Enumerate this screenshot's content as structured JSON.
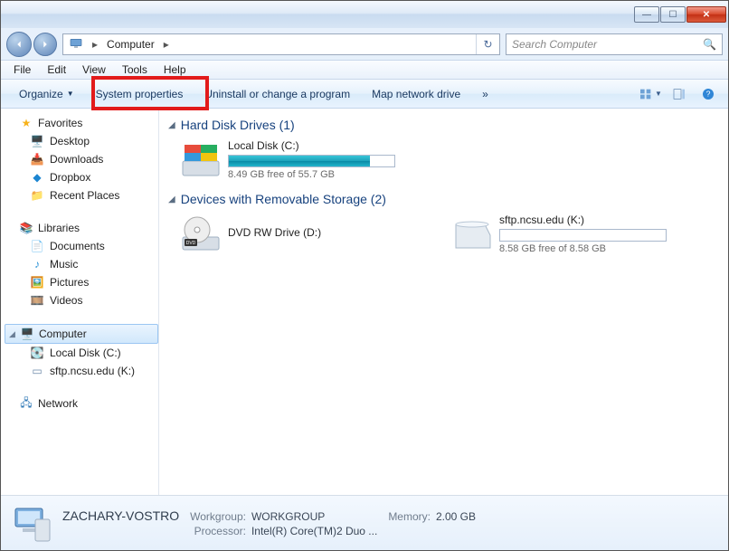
{
  "window_controls": {
    "min": "—",
    "max": "☐",
    "close": "✕"
  },
  "address": {
    "location": "Computer"
  },
  "search": {
    "placeholder": "Search Computer"
  },
  "menus": [
    "File",
    "Edit",
    "View",
    "Tools",
    "Help"
  ],
  "toolbar": {
    "organize": "Organize",
    "system_properties": "System properties",
    "uninstall": "Uninstall or change a program",
    "map_drive": "Map network drive",
    "more": "»"
  },
  "sidebar": {
    "favorites": {
      "label": "Favorites",
      "items": [
        {
          "label": "Desktop",
          "icon": "desktop-icon"
        },
        {
          "label": "Downloads",
          "icon": "downloads-icon"
        },
        {
          "label": "Dropbox",
          "icon": "dropbox-icon"
        },
        {
          "label": "Recent Places",
          "icon": "recent-places-icon"
        }
      ]
    },
    "libraries": {
      "label": "Libraries",
      "items": [
        {
          "label": "Documents",
          "icon": "documents-icon"
        },
        {
          "label": "Music",
          "icon": "music-icon"
        },
        {
          "label": "Pictures",
          "icon": "pictures-icon"
        },
        {
          "label": "Videos",
          "icon": "videos-icon"
        }
      ]
    },
    "computer": {
      "label": "Computer",
      "items": [
        {
          "label": "Local Disk (C:)",
          "icon": "hdd-icon"
        },
        {
          "label": "sftp.ncsu.edu (K:)",
          "icon": "drive-icon"
        }
      ]
    },
    "network": {
      "label": "Network"
    }
  },
  "content": {
    "sections": [
      {
        "title": "Hard Disk Drives (1)",
        "drives": [
          {
            "name": "Local Disk (C:)",
            "free_text": "8.49 GB free of 55.7 GB",
            "used_percent": 85,
            "icon": "hdd-large-icon"
          }
        ]
      },
      {
        "title": "Devices with Removable Storage (2)",
        "drives": [
          {
            "name": "DVD RW Drive (D:)",
            "free_text": "",
            "used_percent": null,
            "icon": "dvd-icon"
          },
          {
            "name": "sftp.ncsu.edu (K:)",
            "free_text": "8.58 GB free of 8.58 GB",
            "used_percent": 0,
            "icon": "removable-icon"
          }
        ]
      }
    ]
  },
  "details": {
    "name": "ZACHARY-VOSTRO",
    "workgroup_label": "Workgroup:",
    "workgroup": "WORKGROUP",
    "memory_label": "Memory:",
    "memory": "2.00 GB",
    "processor_label": "Processor:",
    "processor": "Intel(R) Core(TM)2 Duo ..."
  }
}
